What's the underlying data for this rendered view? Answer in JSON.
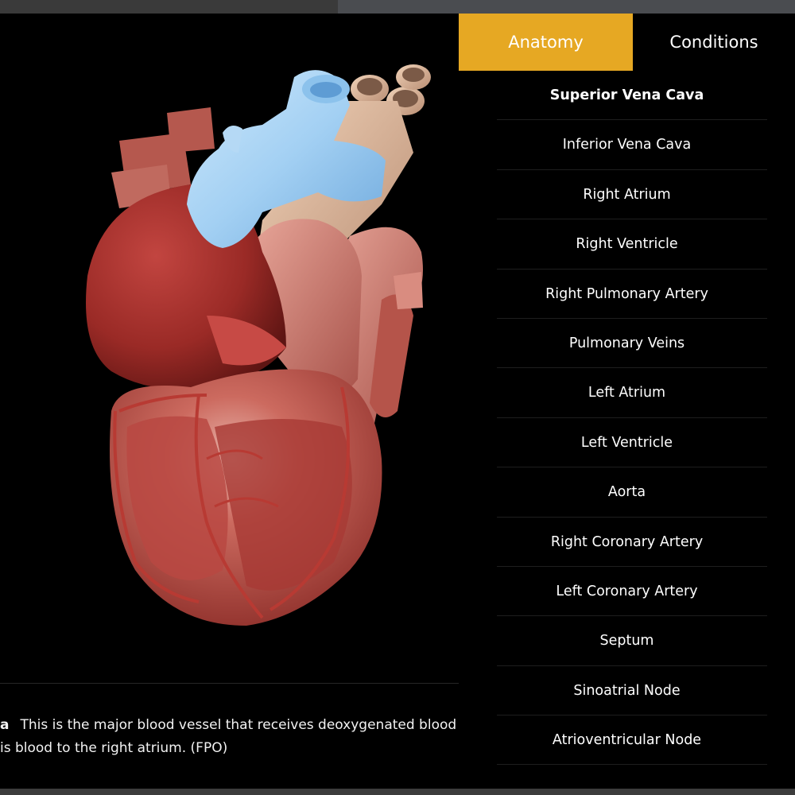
{
  "tabs": {
    "anatomy": "Anatomy",
    "conditions": "Conditions",
    "active": "Anatomy"
  },
  "anatomy_list": [
    "Superior Vena Cava",
    "Inferior Vena Cava",
    "Right Atrium",
    "Right Ventricle",
    "Right Pulmonary Artery",
    "Pulmonary Veins",
    "Left Atrium",
    "Left Ventricle",
    "Aorta",
    "Right Coronary Artery",
    "Left Coronary Artery",
    "Septum",
    "Sinoatrial Node",
    "Atrioventricular Node"
  ],
  "selected_item": "Superior Vena Cava",
  "caption": {
    "term": "a",
    "line1": "This is the major blood vessel that receives deoxygenated blood fro",
    "line2": "is blood to the right atrium. (FPO)"
  },
  "colors": {
    "accent_tab": "#e6a823",
    "highlight_vessel": "#a8d4f5",
    "background": "#000000"
  },
  "icons": {
    "heart_model": "heart-3d-model"
  }
}
